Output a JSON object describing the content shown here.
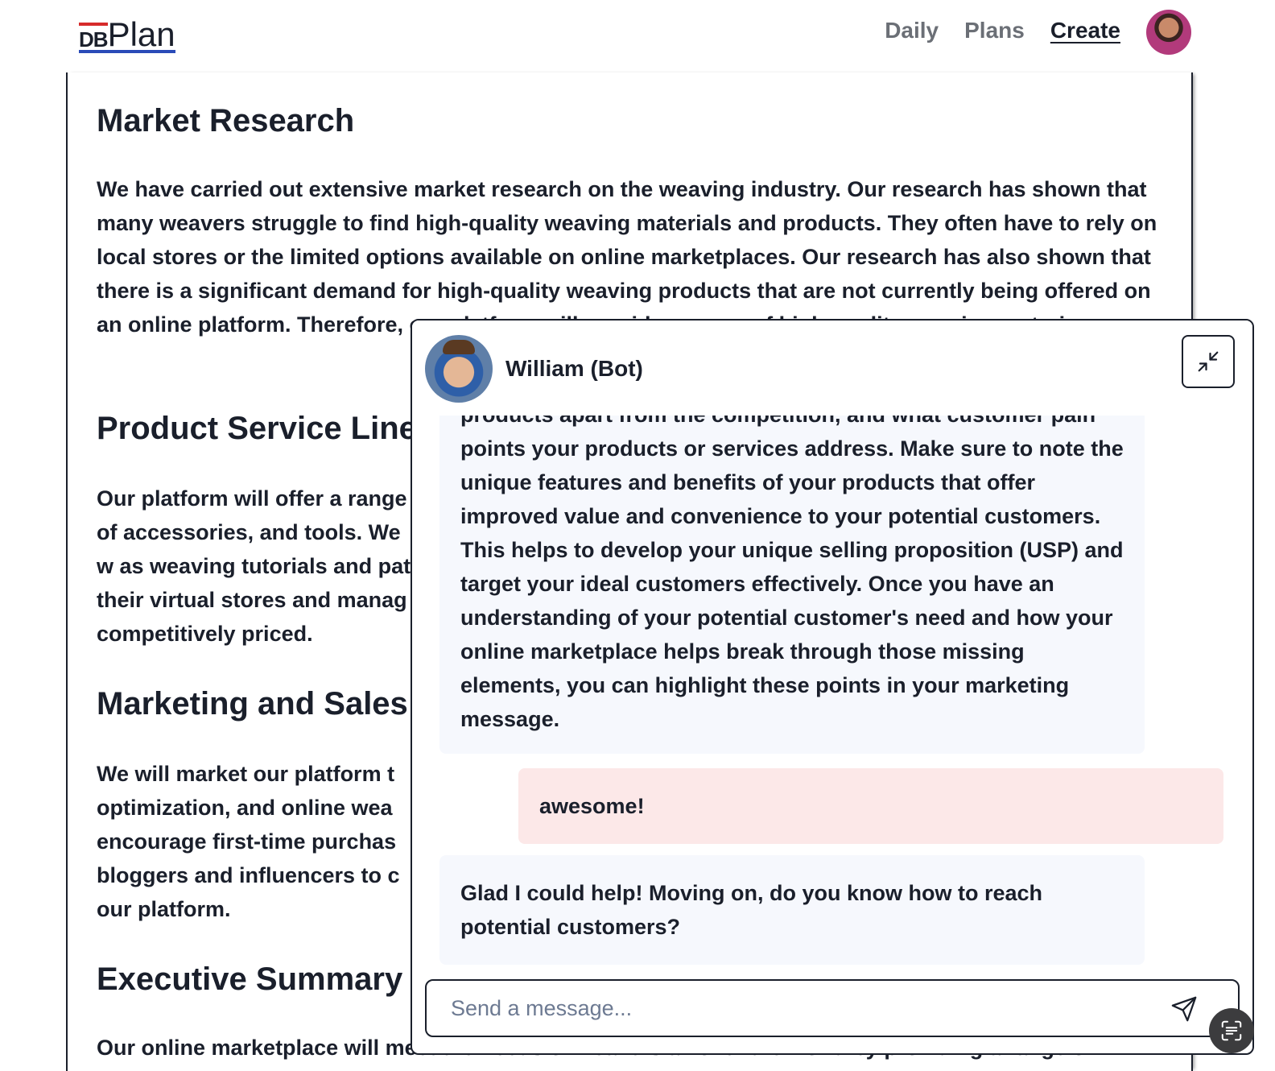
{
  "header": {
    "logo_prefix": "DB",
    "logo_main": "Plan",
    "nav": [
      {
        "label": "Daily"
      },
      {
        "label": "Plans"
      },
      {
        "label": "Create"
      }
    ]
  },
  "document": {
    "sections": [
      {
        "heading": "Market Research",
        "body": "We have carried out extensive market research on the weaving industry. Our research has shown that many weavers struggle to find high-quality weaving materials and products. They often have to rely on local stores or the limited options available on online marketplaces. Our research has also shown that there is a significant demand for high-quality weaving products that are not currently being offered on an online platform. Therefore, our platform will provide a range of high-quality weaving materia"
      },
      {
        "heading": "Product Service Line",
        "body": "Our platform will offer a range of accessories, and tools. We w as weaving tutorials and patt their virtual stores and manag competitively priced."
      },
      {
        "heading": "Marketing and Sales",
        "body": "We will market our platform t optimization, and online wea encourage first-time purchas bloggers and influencers to c our platform."
      },
      {
        "heading": "Executive Summary",
        "body": "Our online marketplace will meet the needs of weavers all over the world by providing a range of"
      }
    ]
  },
  "chat": {
    "bot_name": "William (Bot)",
    "messages": [
      {
        "role": "bot",
        "text": "products apart from the competition, and what customer pain points your products or services address. Make sure to note the unique features and benefits of your products that offer improved value and convenience to your potential customers. This helps to develop your unique selling proposition (USP) and target your ideal customers effectively. Once you have an understanding of your potential customer's need and how your online marketplace helps break through those missing elements, you can highlight these points in your marketing message."
      },
      {
        "role": "user",
        "text": "awesome!"
      },
      {
        "role": "bot",
        "text": "Glad I could help! Moving on, do you know how to reach potential customers?"
      }
    ],
    "input_placeholder": "Send a message..."
  },
  "icons": {
    "minimize": "minimize-icon",
    "send": "send-icon",
    "fab": "scan-text-icon"
  },
  "colors": {
    "text": "#1a1f2b",
    "bot_bubble": "#f6f8fd",
    "user_bubble": "#fce8e8",
    "logo_red": "#d62b2b",
    "logo_blue": "#2a4bb8"
  }
}
